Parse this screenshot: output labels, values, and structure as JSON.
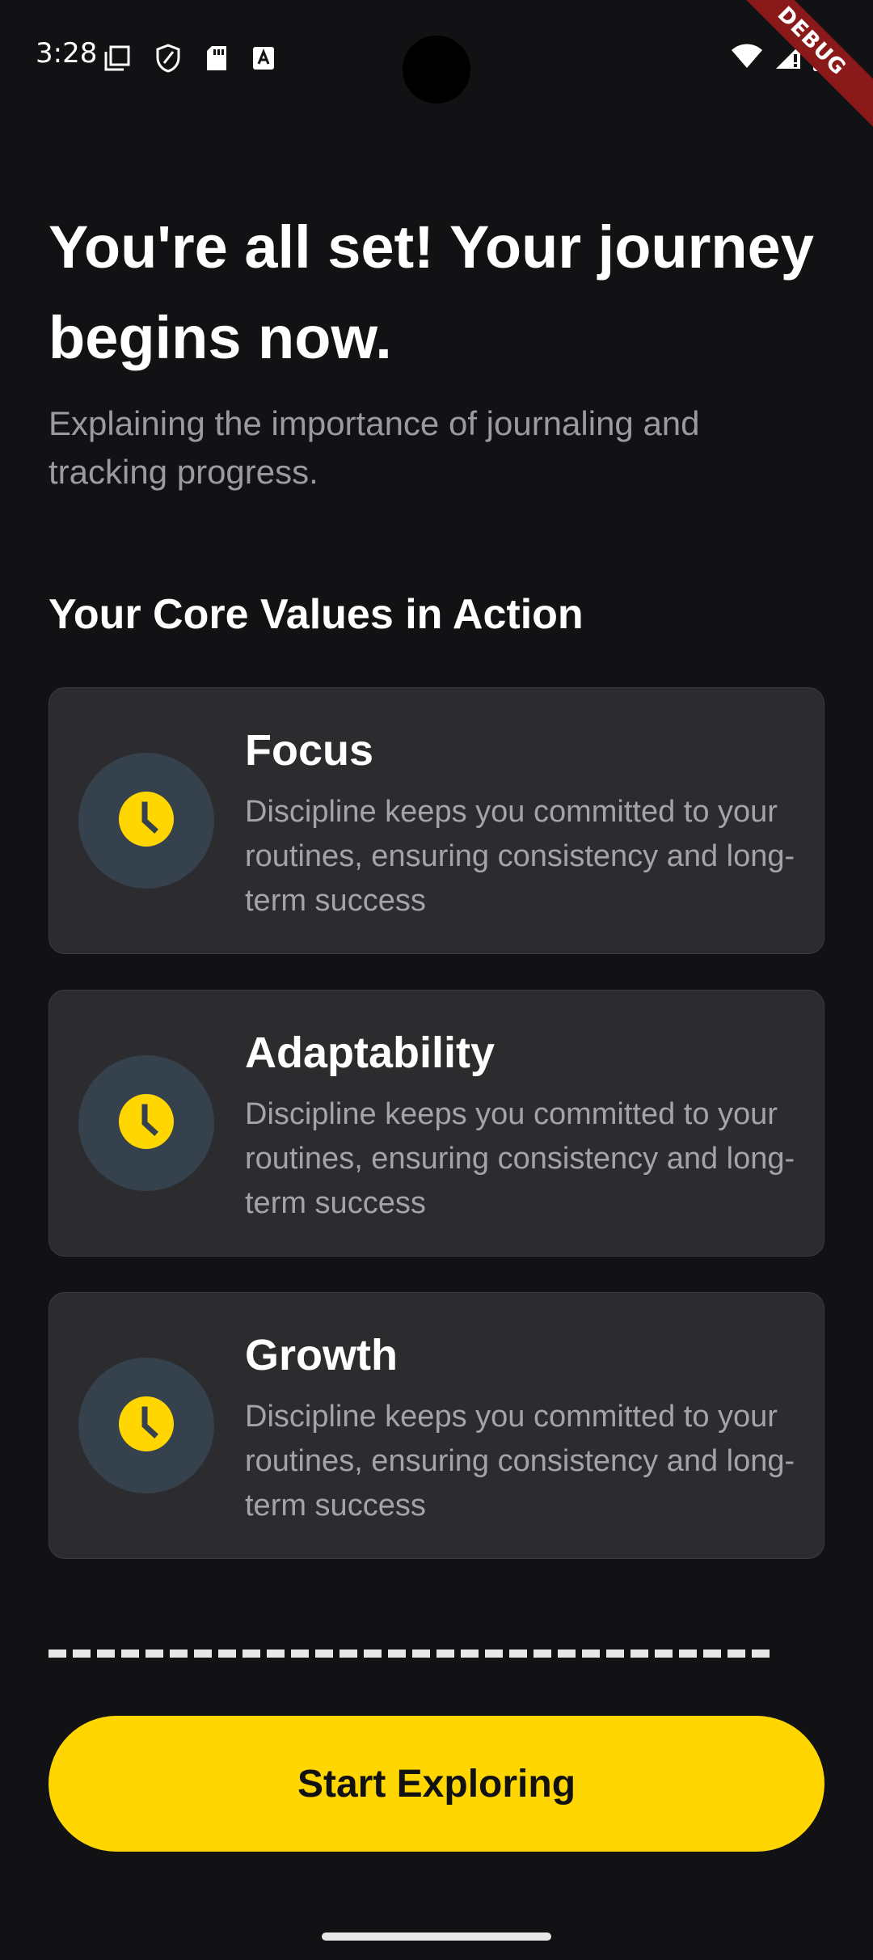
{
  "status_bar": {
    "time": "3:28",
    "left_icons": [
      "copy-icon",
      "shield-icon",
      "sd-card-icon",
      "text-a-icon"
    ],
    "right_icons": [
      "wifi-icon",
      "signal-icon",
      "battery-icon"
    ],
    "debug_label": "DEBUG"
  },
  "header": {
    "title": "You're all set! Your journey begins now.",
    "subtitle": "Explaining the importance of journaling and tracking progress."
  },
  "values_section": {
    "heading": "Your Core Values in Action",
    "cards": [
      {
        "icon": "clock-icon",
        "title": "Focus",
        "description": "Discipline keeps you committed to your routines, ensuring consistency and long-term success"
      },
      {
        "icon": "clock-icon",
        "title": "Adaptability",
        "description": "Discipline keeps you committed to your routines, ensuring consistency and long-term success"
      },
      {
        "icon": "clock-icon",
        "title": "Growth",
        "description": "Discipline keeps you committed to your routines, ensuring consistency and long-term success"
      }
    ]
  },
  "cta": {
    "label": "Start Exploring"
  },
  "colors": {
    "background": "#121214",
    "card_background": "#2c2c2e",
    "accent": "#ffd600",
    "icon_circle": "#35414d",
    "secondary_text": "#9a9aa0",
    "debug_banner": "#8a1a1a"
  }
}
